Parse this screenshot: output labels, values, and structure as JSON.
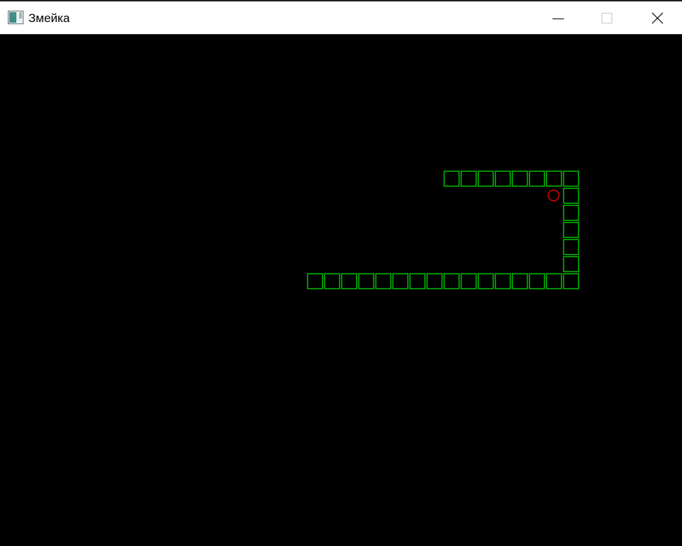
{
  "window": {
    "title": "Змейка",
    "icon": "app-window-icon",
    "controls": {
      "minimize_icon": "minimize-icon",
      "maximize_icon": "maximize-icon",
      "close_icon": "close-icon"
    }
  },
  "game": {
    "background_color": "#000000",
    "snake_color": "#00c000",
    "food_color": "#e00000",
    "snake_cells": [
      [
        26,
        8
      ],
      [
        27,
        8
      ],
      [
        28,
        8
      ],
      [
        29,
        8
      ],
      [
        30,
        8
      ],
      [
        31,
        8
      ],
      [
        32,
        8
      ],
      [
        33,
        8
      ],
      [
        33,
        9
      ],
      [
        33,
        10
      ],
      [
        33,
        11
      ],
      [
        33,
        12
      ],
      [
        33,
        13
      ],
      [
        33,
        14
      ],
      [
        32,
        14
      ],
      [
        31,
        14
      ],
      [
        30,
        14
      ],
      [
        29,
        14
      ],
      [
        28,
        14
      ],
      [
        27,
        14
      ],
      [
        26,
        14
      ],
      [
        25,
        14
      ],
      [
        24,
        14
      ],
      [
        23,
        14
      ],
      [
        22,
        14
      ],
      [
        21,
        14
      ],
      [
        20,
        14
      ],
      [
        19,
        14
      ],
      [
        18,
        14
      ]
    ],
    "food_cell": [
      32,
      9
    ]
  }
}
